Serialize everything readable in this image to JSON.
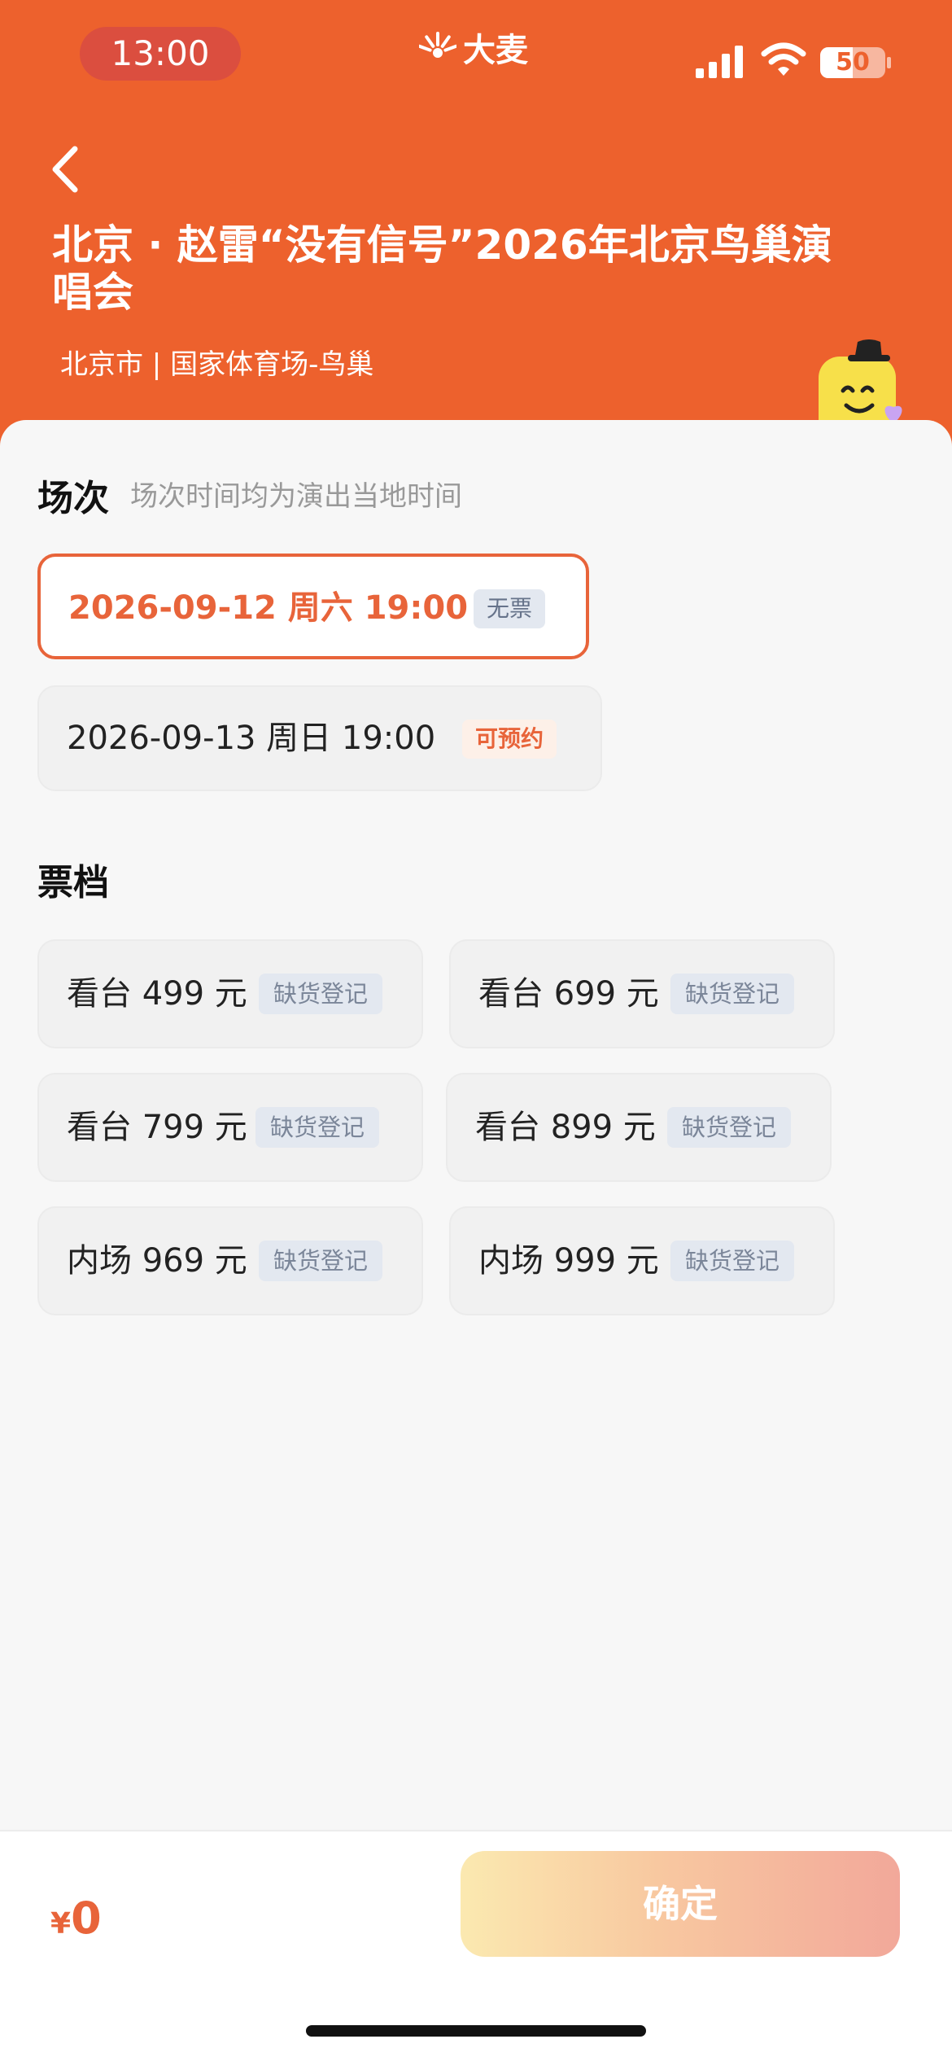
{
  "status_bar": {
    "time": "13:00",
    "brand": "大麦",
    "battery": "50",
    "battery_level": 0.5
  },
  "header": {
    "title": "北京 · 赵雷“没有信号”2026年北京鸟巢演唱会",
    "venue": "北京市 | 国家体育场-鸟巢"
  },
  "sessions": {
    "title": "场次",
    "hint": "场次时间均为演出当地时间",
    "items": [
      {
        "label": "2026-09-12  周六 19:00",
        "tag": "无票",
        "selected": true
      },
      {
        "label": "2026-09-13 周日 19:00",
        "tag": "可预约",
        "selected": false
      }
    ]
  },
  "tickets": {
    "title": "票档",
    "items": [
      {
        "label": "看台 499 元",
        "tag": "缺货登记"
      },
      {
        "label": "看台 699 元",
        "tag": "缺货登记"
      },
      {
        "label": "看台 799 元",
        "tag": "缺货登记"
      },
      {
        "label": "看台 899 元",
        "tag": "缺货登记"
      },
      {
        "label": "内场 969 元",
        "tag": "缺货登记"
      },
      {
        "label": "内场 999 元",
        "tag": "缺货登记"
      }
    ]
  },
  "footer": {
    "currency": "¥",
    "price": "0",
    "confirm_label": "确定"
  },
  "colors": {
    "brand_orange": "#ed612d",
    "accent": "#e8643a"
  },
  "icons": [
    "back-icon",
    "signal-icon",
    "wifi-icon",
    "battery-icon",
    "brand-logo-icon",
    "mascot-icon"
  ]
}
